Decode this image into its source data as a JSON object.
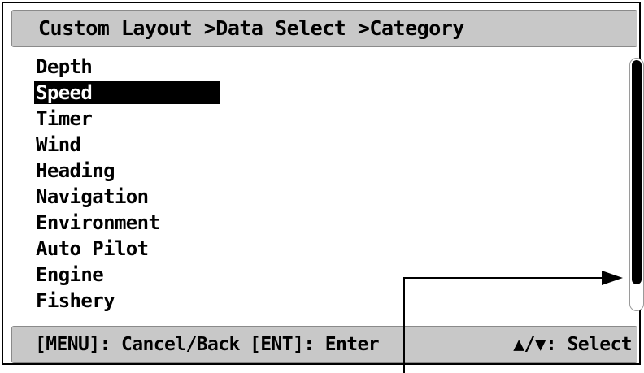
{
  "header": {
    "breadcrumb": "Custom Layout >Data Select >Category"
  },
  "category_list": {
    "selected_index": 1,
    "items": [
      {
        "label": "Depth"
      },
      {
        "label": "Speed"
      },
      {
        "label": "Timer"
      },
      {
        "label": "Wind"
      },
      {
        "label": "Heading"
      },
      {
        "label": "Navigation"
      },
      {
        "label": "Environment"
      },
      {
        "label": "Auto Pilot"
      },
      {
        "label": "Engine"
      },
      {
        "label": "Fishery"
      }
    ]
  },
  "footer": {
    "menu_hint": "[MENU]: Cancel/Back",
    "enter_hint": "[ENT]: Enter",
    "select_hint": "▲/▼: Select"
  },
  "colors": {
    "bar_gray": "#c8c8c8",
    "highlight": "#000000",
    "text": "#000000"
  },
  "icons": {
    "scrollbar": "scrollbar-thumb",
    "callout": "callout-arrow-icon"
  }
}
